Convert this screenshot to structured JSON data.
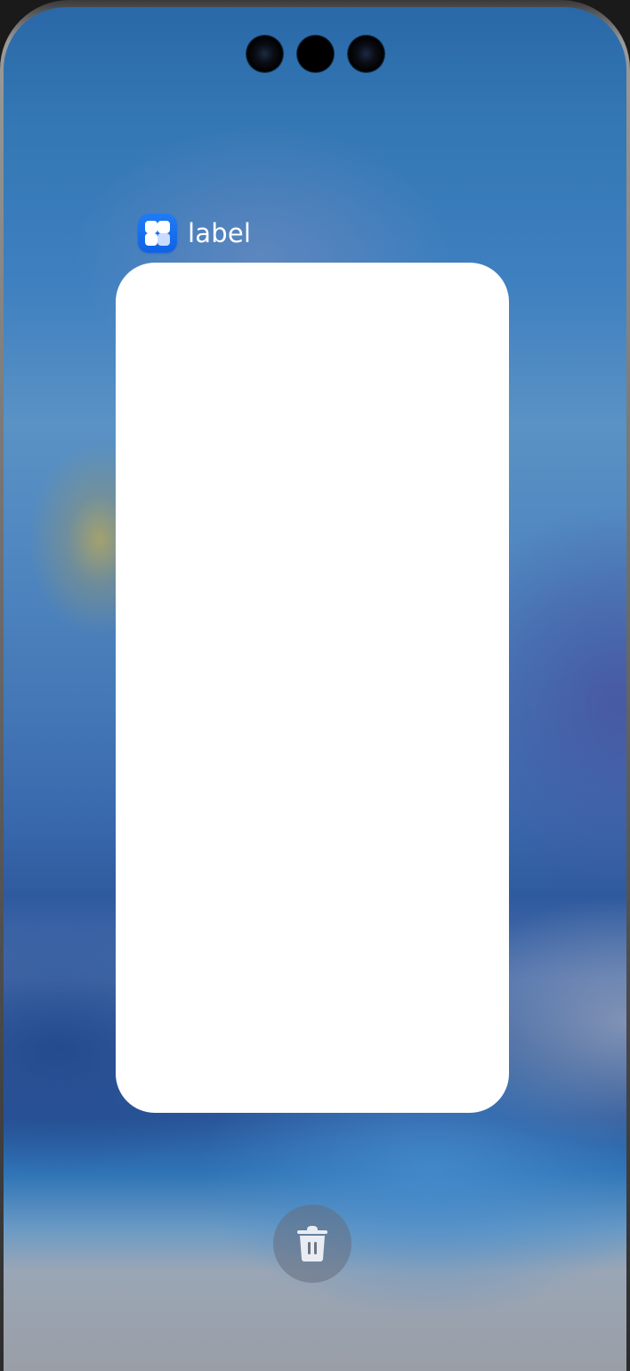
{
  "recents": {
    "app_label": "label",
    "app_icon": "app-grid-icon",
    "clear_icon": "trash-icon"
  },
  "colors": {
    "app_icon_background": "#1f7cf5",
    "card_background": "#ffffff",
    "label_text": "#ffffff",
    "trash_button_background": "#646e7d"
  }
}
